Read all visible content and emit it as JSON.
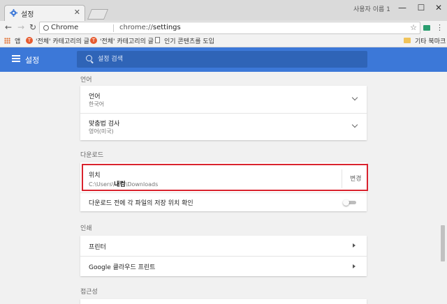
{
  "browser": {
    "tab_title": "설정",
    "tab_close": "✕",
    "profile_name": "사용자 이름 1",
    "window_controls": {
      "minimize": "—",
      "maximize": "☐",
      "close": "✕"
    },
    "site_name": "Chrome",
    "url_scheme": "chrome://",
    "url_path": "settings",
    "bookmarks": {
      "apps_label": "앱",
      "item1": "'전체' 카테고리의 글",
      "item2": "'전체' 카테고리의 글",
      "item3": "인기 콘텐츠를 도입",
      "other": "기타 북마크"
    },
    "icons": [
      "gear-icon",
      "back-arrow-icon",
      "forward-arrow-icon",
      "reload-icon",
      "star-icon",
      "menu-icon",
      "folder-icon",
      "apps-grid-icon"
    ]
  },
  "header": {
    "menu_icon": "hamburger-icon",
    "title": "설정",
    "search_placeholder": "설정 검색",
    "color": "#3c78d8"
  },
  "sections": {
    "language": {
      "title": "언어",
      "language_row": {
        "title": "언어",
        "value": "한국어"
      },
      "spellcheck_row": {
        "title": "맞춤법 검사",
        "value": "영어(미국)"
      }
    },
    "downloads": {
      "title": "다운로드",
      "location_row": {
        "title": "위치",
        "path_prefix": "C:\\Users\\",
        "path_user": "내컴",
        "path_suffix": "\\Downloads",
        "change_label": "변경",
        "highlight_color": "#d9232e"
      },
      "ask_row": {
        "title": "다운로드 전에 각 파일의 저장 위치 확인",
        "enabled": false
      }
    },
    "printing": {
      "title": "인쇄",
      "printers_row": {
        "title": "프린터"
      },
      "cloud_print_row": {
        "title": "Google 클라우드 프린트"
      }
    },
    "accessibility": {
      "title": "접근성"
    }
  }
}
